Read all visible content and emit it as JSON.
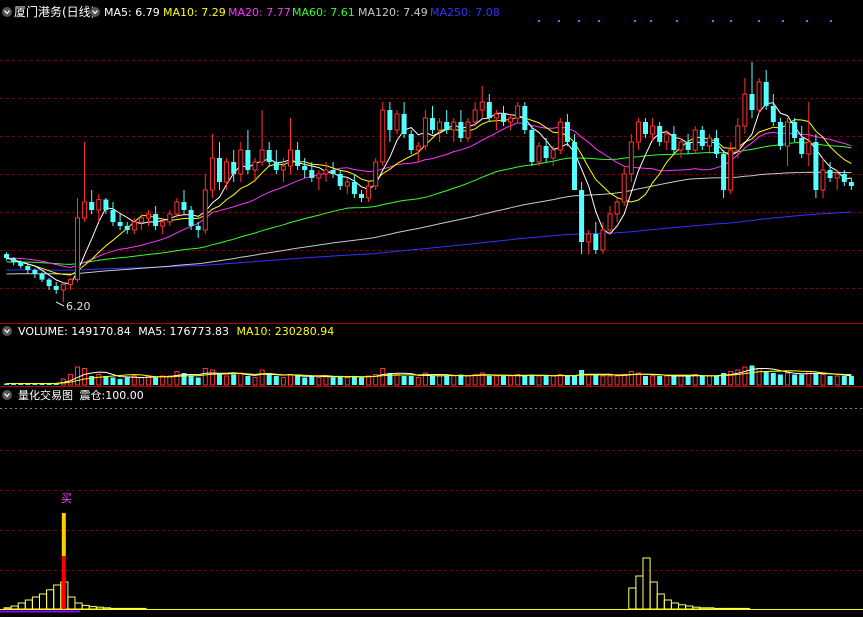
{
  "main_panel": {
    "title": "厦门港务(日线)",
    "indicators": [
      {
        "label": "MA5:",
        "value": "6.79",
        "color": "#ffffff"
      },
      {
        "label": "MA10:",
        "value": "7.29",
        "color": "#ffff00"
      },
      {
        "label": "MA20:",
        "value": "7.77",
        "color": "#ff33ff"
      },
      {
        "label": "MA60:",
        "value": "7.61",
        "color": "#33ff33"
      },
      {
        "label": "MA120:",
        "value": "7.49",
        "color": "#c8c8c8"
      },
      {
        "label": "MA250:",
        "value": "7.08",
        "color": "#3333ff"
      }
    ],
    "low_label": "6.20"
  },
  "volume_panel": {
    "indicators": [
      {
        "label": "VOLUME:",
        "value": "149170.84",
        "color": "#ffffff"
      },
      {
        "label": "MA5:",
        "value": "176773.83",
        "color": "#ffffff"
      },
      {
        "label": "MA10:",
        "value": "230280.94",
        "color": "#ffff00"
      }
    ]
  },
  "quant_panel": {
    "title": "量化交易图",
    "status_label": "震仓:",
    "status_value": "100.00",
    "buy_marker": "买"
  },
  "colors": {
    "up": "#ff3232",
    "down": "#54ffff",
    "grid": "#7a0000",
    "frame": "#b00000",
    "text": "#e0e0e0",
    "signal_red": "#ff0000",
    "signal_yellow": "#ffcc00"
  },
  "chart_data": [
    {
      "type": "candlestick",
      "title": "厦门港务(日线)",
      "ohlc": [
        [
          6.8,
          6.82,
          6.72,
          6.75
        ],
        [
          6.75,
          6.76,
          6.66,
          6.7
        ],
        [
          6.7,
          6.72,
          6.62,
          6.65
        ],
        [
          6.65,
          6.67,
          6.55,
          6.6
        ],
        [
          6.6,
          6.62,
          6.5,
          6.55
        ],
        [
          6.55,
          6.57,
          6.45,
          6.48
        ],
        [
          6.48,
          6.5,
          6.35,
          6.4
        ],
        [
          6.4,
          6.45,
          6.3,
          6.35
        ],
        [
          6.35,
          6.45,
          6.2,
          6.42
        ],
        [
          6.42,
          6.5,
          6.35,
          6.48
        ],
        [
          6.48,
          7.5,
          6.45,
          7.25
        ],
        [
          7.25,
          8.2,
          7.2,
          7.45
        ],
        [
          7.45,
          7.6,
          7.3,
          7.35
        ],
        [
          7.35,
          7.55,
          7.2,
          7.48
        ],
        [
          7.48,
          7.5,
          7.3,
          7.35
        ],
        [
          7.35,
          7.45,
          7.15,
          7.2
        ],
        [
          7.2,
          7.3,
          7.1,
          7.15
        ],
        [
          7.15,
          7.2,
          7.05,
          7.1
        ],
        [
          7.1,
          7.25,
          7.05,
          7.2
        ],
        [
          7.2,
          7.3,
          7.1,
          7.25
        ],
        [
          7.25,
          7.35,
          7.15,
          7.3
        ],
        [
          7.3,
          7.4,
          7.1,
          7.15
        ],
        [
          7.15,
          7.25,
          7.05,
          7.2
        ],
        [
          7.2,
          7.35,
          7.15,
          7.3
        ],
        [
          7.3,
          7.5,
          7.25,
          7.45
        ],
        [
          7.45,
          7.6,
          7.3,
          7.35
        ],
        [
          7.35,
          7.4,
          7.1,
          7.15
        ],
        [
          7.15,
          7.2,
          7.0,
          7.1
        ],
        [
          7.1,
          7.8,
          7.05,
          7.6
        ],
        [
          7.6,
          8.3,
          7.5,
          8.0
        ],
        [
          8.0,
          8.2,
          7.6,
          7.7
        ],
        [
          7.7,
          8.0,
          7.6,
          7.95
        ],
        [
          7.95,
          8.1,
          7.7,
          7.8
        ],
        [
          7.8,
          8.2,
          7.7,
          8.1
        ],
        [
          8.1,
          8.35,
          7.8,
          7.85
        ],
        [
          7.85,
          8.0,
          7.7,
          7.95
        ],
        [
          7.95,
          8.6,
          7.9,
          8.1
        ],
        [
          8.1,
          8.2,
          7.9,
          7.95
        ],
        [
          7.95,
          8.1,
          7.8,
          7.85
        ],
        [
          7.85,
          8.0,
          7.7,
          7.9
        ],
        [
          7.9,
          8.5,
          7.8,
          8.1
        ],
        [
          8.1,
          8.2,
          7.85,
          7.9
        ],
        [
          7.9,
          8.0,
          7.75,
          7.85
        ],
        [
          7.85,
          7.95,
          7.7,
          7.75
        ],
        [
          7.75,
          7.85,
          7.6,
          7.8
        ],
        [
          7.8,
          7.95,
          7.7,
          7.85
        ],
        [
          7.85,
          7.95,
          7.75,
          7.8
        ],
        [
          7.8,
          7.85,
          7.6,
          7.65
        ],
        [
          7.65,
          7.75,
          7.55,
          7.7
        ],
        [
          7.7,
          7.8,
          7.5,
          7.55
        ],
        [
          7.55,
          7.6,
          7.45,
          7.5
        ],
        [
          7.5,
          7.7,
          7.45,
          7.65
        ],
        [
          7.65,
          8.0,
          7.6,
          7.95
        ],
        [
          7.95,
          8.7,
          7.9,
          8.6
        ],
        [
          8.6,
          8.7,
          8.2,
          8.35
        ],
        [
          8.35,
          8.6,
          8.3,
          8.55
        ],
        [
          8.55,
          8.7,
          8.25,
          8.3
        ],
        [
          8.3,
          8.35,
          8.05,
          8.1
        ],
        [
          8.1,
          8.2,
          7.95,
          8.15
        ],
        [
          8.15,
          8.6,
          8.1,
          8.5
        ],
        [
          8.5,
          8.65,
          8.3,
          8.35
        ],
        [
          8.35,
          8.5,
          8.2,
          8.45
        ],
        [
          8.45,
          8.6,
          8.3,
          8.35
        ],
        [
          8.35,
          8.5,
          8.2,
          8.45
        ],
        [
          8.45,
          8.6,
          8.2,
          8.25
        ],
        [
          8.25,
          8.5,
          8.2,
          8.45
        ],
        [
          8.45,
          8.7,
          8.4,
          8.6
        ],
        [
          8.6,
          8.9,
          8.5,
          8.7
        ],
        [
          8.7,
          8.8,
          8.45,
          8.5
        ],
        [
          8.5,
          8.6,
          8.35,
          8.55
        ],
        [
          8.55,
          8.65,
          8.4,
          8.45
        ],
        [
          8.45,
          8.55,
          8.35,
          8.5
        ],
        [
          8.5,
          8.7,
          8.45,
          8.65
        ],
        [
          8.65,
          8.7,
          8.3,
          8.35
        ],
        [
          8.35,
          8.4,
          7.9,
          7.95
        ],
        [
          7.95,
          8.2,
          7.9,
          8.15
        ],
        [
          8.15,
          8.25,
          7.95,
          8.0
        ],
        [
          8.0,
          8.15,
          7.9,
          8.1
        ],
        [
          8.1,
          8.5,
          8.05,
          8.45
        ],
        [
          8.45,
          8.55,
          8.15,
          8.2
        ],
        [
          8.2,
          8.3,
          7.9,
          7.6
        ],
        [
          7.6,
          7.7,
          6.8,
          6.95
        ],
        [
          6.95,
          7.1,
          6.8,
          7.05
        ],
        [
          7.05,
          7.2,
          6.8,
          6.85
        ],
        [
          6.85,
          7.2,
          6.8,
          7.1
        ],
        [
          7.1,
          7.4,
          7.05,
          7.3
        ],
        [
          7.3,
          7.5,
          7.2,
          7.45
        ],
        [
          7.45,
          7.9,
          7.4,
          7.8
        ],
        [
          7.8,
          8.3,
          7.7,
          8.2
        ],
        [
          8.2,
          8.5,
          8.1,
          8.45
        ],
        [
          8.45,
          8.5,
          8.25,
          8.3
        ],
        [
          8.3,
          8.5,
          8.2,
          8.4
        ],
        [
          8.4,
          8.45,
          8.15,
          8.2
        ],
        [
          8.2,
          8.35,
          8.1,
          8.3
        ],
        [
          8.3,
          8.4,
          8.05,
          8.1
        ],
        [
          8.1,
          8.25,
          8.0,
          8.2
        ],
        [
          8.2,
          8.3,
          8.05,
          8.1
        ],
        [
          8.1,
          8.4,
          8.05,
          8.35
        ],
        [
          8.35,
          8.4,
          8.1,
          8.15
        ],
        [
          8.15,
          8.3,
          8.05,
          8.25
        ],
        [
          8.25,
          8.35,
          8.0,
          8.05
        ],
        [
          8.05,
          8.1,
          7.5,
          7.6
        ],
        [
          7.6,
          8.2,
          7.55,
          8.1
        ],
        [
          8.1,
          8.5,
          8.0,
          8.4
        ],
        [
          8.4,
          9.0,
          8.3,
          8.8
        ],
        [
          8.8,
          9.2,
          8.5,
          8.6
        ],
        [
          8.6,
          9.0,
          8.55,
          8.95
        ],
        [
          8.95,
          9.1,
          8.6,
          8.65
        ],
        [
          8.65,
          8.8,
          8.4,
          8.45
        ],
        [
          8.45,
          8.5,
          8.1,
          8.15
        ],
        [
          8.15,
          8.5,
          7.9,
          8.45
        ],
        [
          8.45,
          8.5,
          8.2,
          8.25
        ],
        [
          8.25,
          8.4,
          8.0,
          8.05
        ],
        [
          8.05,
          8.7,
          7.9,
          8.2
        ],
        [
          8.2,
          8.3,
          7.5,
          7.6
        ],
        [
          7.6,
          8.0,
          7.5,
          7.85
        ],
        [
          7.85,
          7.95,
          7.7,
          7.75
        ],
        [
          7.75,
          7.85,
          7.6,
          7.8
        ],
        [
          7.8,
          7.85,
          7.65,
          7.7
        ],
        [
          7.7,
          7.75,
          7.6,
          7.65
        ]
      ],
      "ma_values": {
        "MA5": 6.79,
        "MA10": 7.29,
        "MA20": 7.77,
        "MA60": 7.61,
        "MA120": 7.49,
        "MA250": 7.08
      },
      "annotations": [
        "6.20"
      ],
      "grid": true
    },
    {
      "type": "bar",
      "title": "VOLUME",
      "values": [
        0.05,
        0.05,
        0.05,
        0.05,
        0.05,
        0.05,
        0.05,
        0.06,
        0.2,
        0.35,
        0.6,
        0.55,
        0.3,
        0.35,
        0.3,
        0.25,
        0.2,
        0.25,
        0.3,
        0.25,
        0.3,
        0.25,
        0.3,
        0.3,
        0.45,
        0.4,
        0.3,
        0.25,
        0.55,
        0.5,
        0.35,
        0.3,
        0.35,
        0.4,
        0.3,
        0.25,
        0.5,
        0.35,
        0.3,
        0.25,
        0.35,
        0.3,
        0.25,
        0.3,
        0.25,
        0.3,
        0.25,
        0.3,
        0.25,
        0.3,
        0.25,
        0.3,
        0.35,
        0.55,
        0.4,
        0.35,
        0.3,
        0.3,
        0.25,
        0.4,
        0.3,
        0.3,
        0.3,
        0.3,
        0.35,
        0.3,
        0.35,
        0.4,
        0.3,
        0.3,
        0.3,
        0.3,
        0.35,
        0.3,
        0.35,
        0.3,
        0.3,
        0.3,
        0.35,
        0.3,
        0.3,
        0.5,
        0.35,
        0.35,
        0.3,
        0.3,
        0.3,
        0.35,
        0.45,
        0.4,
        0.3,
        0.3,
        0.3,
        0.3,
        0.3,
        0.3,
        0.3,
        0.35,
        0.3,
        0.3,
        0.3,
        0.4,
        0.45,
        0.5,
        0.6,
        0.65,
        0.55,
        0.45,
        0.4,
        0.35,
        0.4,
        0.35,
        0.35,
        0.45,
        0.4,
        0.35,
        0.3,
        0.3,
        0.3,
        0.3
      ],
      "series_values": {
        "VOLUME": 149170.84,
        "MA5": 176773.83,
        "MA10": 230280.94
      }
    },
    {
      "type": "bar",
      "title": "量化交易图",
      "values": [
        0.02,
        0.05,
        0.1,
        0.15,
        0.2,
        0.25,
        0.32,
        0.4,
        0.45,
        0.2,
        0.1,
        0.06,
        0.04,
        0.03,
        0.02,
        0.01,
        0.01,
        0.01,
        0.01,
        0.01,
        0,
        0,
        0,
        0,
        0,
        0,
        0,
        0,
        0,
        0,
        0,
        0,
        0,
        0,
        0,
        0,
        0,
        0,
        0,
        0,
        0,
        0,
        0,
        0,
        0,
        0,
        0,
        0,
        0,
        0,
        0,
        0,
        0,
        0,
        0,
        0,
        0,
        0,
        0,
        0,
        0,
        0,
        0,
        0,
        0,
        0,
        0,
        0,
        0,
        0,
        0,
        0,
        0,
        0,
        0,
        0,
        0,
        0,
        0,
        0,
        0,
        0,
        0,
        0,
        0,
        0,
        0,
        0,
        0.35,
        0.55,
        0.85,
        0.45,
        0.25,
        0.15,
        0.1,
        0.07,
        0.05,
        0.03,
        0.02,
        0.02,
        0.01,
        0.01,
        0.01,
        0.01,
        0.01,
        0,
        0,
        0,
        0,
        0,
        0,
        0,
        0,
        0,
        0,
        0,
        0,
        0,
        0,
        0
      ],
      "signal_index": 8,
      "signal_level": 1.6,
      "series_values": {
        "震仓": 100.0
      }
    }
  ]
}
